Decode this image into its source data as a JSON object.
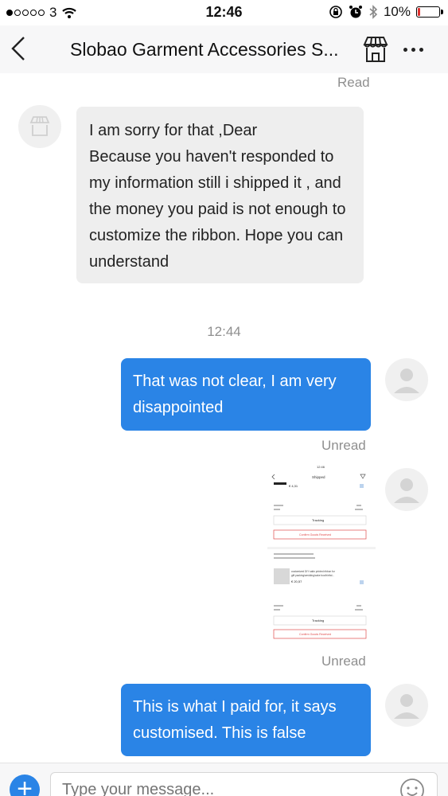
{
  "status_bar": {
    "carrier": "3",
    "time": "12:46",
    "battery": "10%",
    "battery_level": 0.1
  },
  "header": {
    "title": "Slobao Garment Accessories S..."
  },
  "messages": {
    "read_label": "Read",
    "seller_text": "I am sorry for that ,Dear\nBecause you haven't responded to my information still i shipped it , and the money you paid is not enough to customize the ribbon. Hope you can understand",
    "timestamp": "12:44",
    "buyer_text_1": "That was not clear, I am very disappointed",
    "unread_1": "Unread",
    "unread_2": "Unread",
    "buyer_text_2": "This is what I paid for, it says customised.  This is false"
  },
  "screenshot_image": {
    "time": "12:46",
    "title": "Shipped",
    "price_1": "€ 4,31",
    "tracking_1": "Tracking",
    "confirm_1": "Confirm Goods Received",
    "product": "customized DIY satin printed ribbon for gift packing/wedding/cake box/birthd...",
    "price_2": "€ 20,57",
    "tracking_2": "Tracking",
    "confirm_2": "Confirm Goods Received"
  },
  "input": {
    "placeholder": "Type your message..."
  },
  "colors": {
    "accent": "#2a84e6",
    "incoming_bubble": "#eeeeee"
  }
}
